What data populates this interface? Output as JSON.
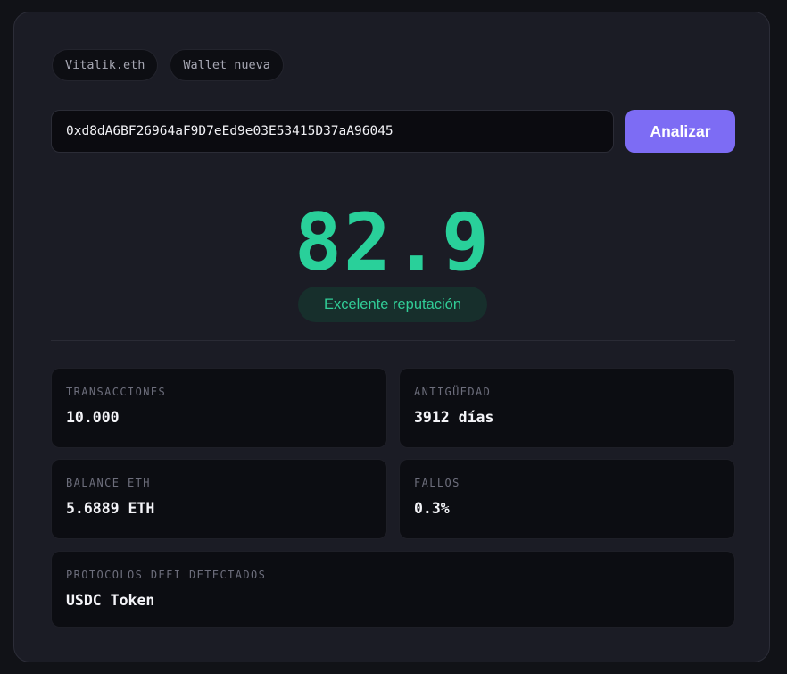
{
  "chips": [
    {
      "label": "Vitalik.eth"
    },
    {
      "label": "Wallet nueva"
    }
  ],
  "search": {
    "value": "0xd8dA6BF26964aF9D7eEd9e03E53415D37aA96045",
    "button_label": "Analizar"
  },
  "score": {
    "value": "82.9",
    "label": "Excelente reputación",
    "color": "#29d09a"
  },
  "stats": {
    "transactions": {
      "label": "TRANSACCIONES",
      "value": "10.000"
    },
    "age": {
      "label": "ANTIGÜEDAD",
      "value": "3912 días"
    },
    "balance": {
      "label": "BALANCE ETH",
      "value": "5.6889 ETH"
    },
    "failures": {
      "label": "FALLOS",
      "value": "0.3%"
    },
    "defi": {
      "label": "PROTOCOLOS DEFI DETECTADOS",
      "value": "USDC Token"
    }
  },
  "colors": {
    "accent": "#7d6cf4",
    "success": "#29d09a",
    "background": "#1b1c25"
  }
}
